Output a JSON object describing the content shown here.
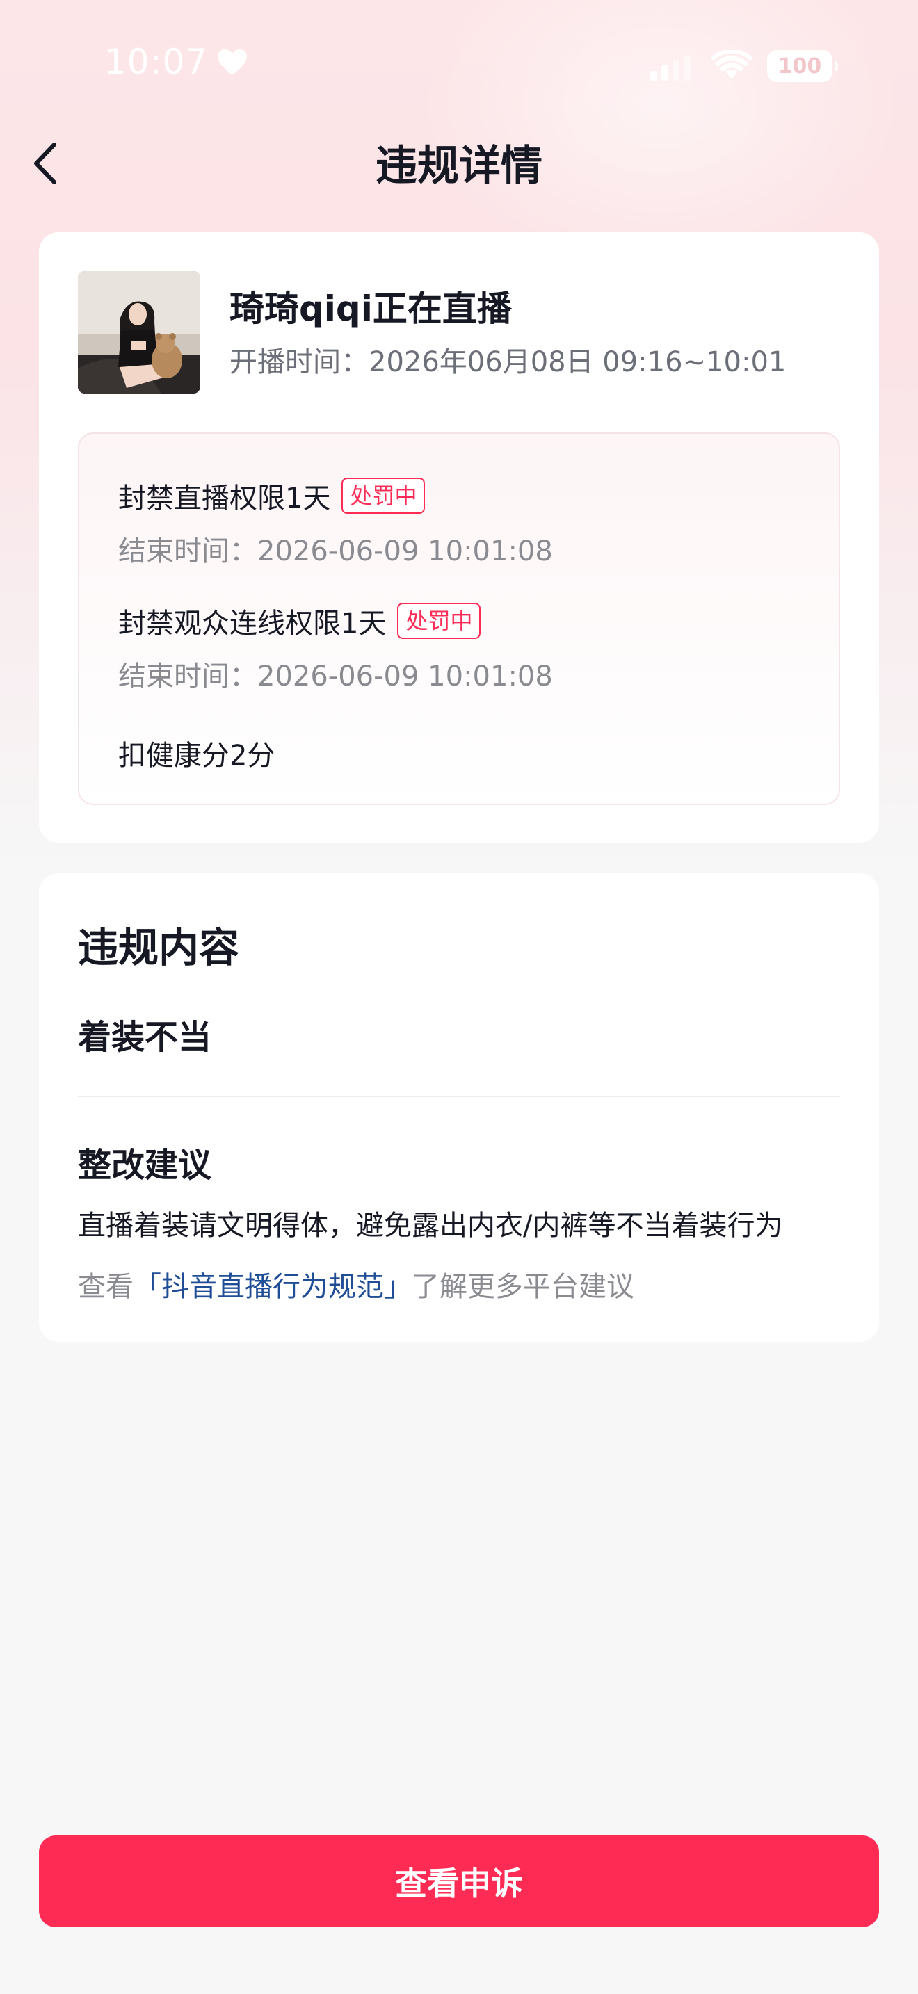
{
  "status_bar": {
    "time": "10:07",
    "battery": "100"
  },
  "nav": {
    "title": "违规详情"
  },
  "stream": {
    "title": "琦琦qiqi正在直播",
    "time": "开播时间：2026年06月08日 09:16~10:01"
  },
  "penalties": [
    {
      "name": "封禁直播权限1天",
      "badge": "处罚中",
      "end": "结束时间：2026-06-09 10:01:08"
    },
    {
      "name": "封禁观众连线权限1天",
      "badge": "处罚中",
      "end": "结束时间：2026-06-09 10:01:08"
    }
  ],
  "health": "扣健康分2分",
  "violation": {
    "section_title": "违规内容",
    "type": "着装不当",
    "advice_title": "整改建议",
    "advice_text": "直播着装请文明得体，避免露出内衣/内裤等不当着装行为",
    "link_prefix": "查看",
    "link_text": "「抖音直播行为规范」",
    "link_suffix": "了解更多平台建议"
  },
  "appeal_button": "查看申诉",
  "colors": {
    "accent": "#fe2c55",
    "link": "#1f4e96"
  }
}
